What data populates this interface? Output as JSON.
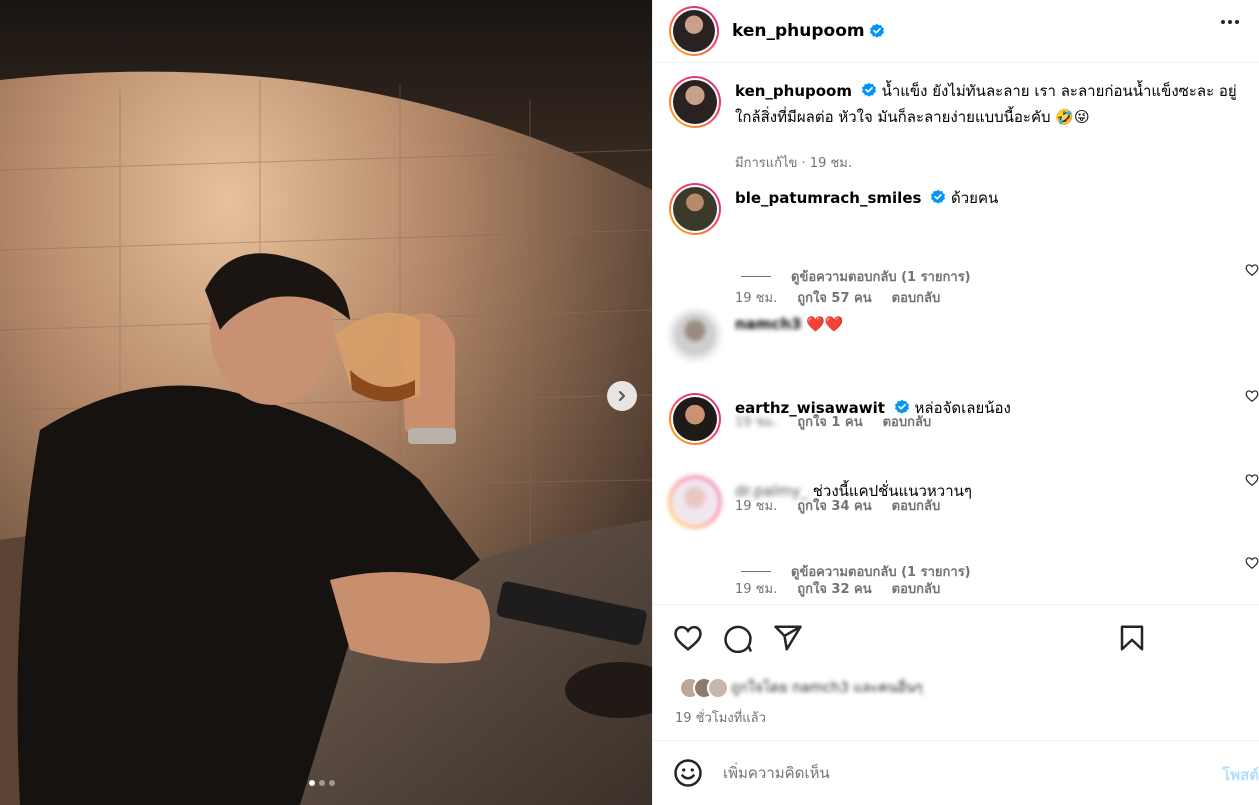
{
  "author": {
    "username": "ken_phupoom",
    "verified": true
  },
  "caption": {
    "username": "ken_phupoom",
    "text": "น้ำแข็ง ยังไม่ทันละลาย เรา ละลายก่อนน้ำแข็งซะละ อยู่ใกล้สิ่งที่มีผลต่อ หัวใจ มันก็ละลายง่ายแบบนี้อะคับ 🤣😜",
    "meta": "มีการแก้ไข · 19 ชม."
  },
  "comments": [
    {
      "username": "ble_patumrach_smiles",
      "verified": true,
      "text": "ด้วยคน",
      "time": "19 ชม.",
      "likes": "ถูกใจ 57 คน",
      "reply": "ตอบกลับ",
      "view_replies": "ดูข้อความตอบกลับ (1 รายการ)"
    },
    {
      "username": "namch3",
      "verified": false,
      "text": "❤️❤️",
      "time": "19 ชม.",
      "likes": "ถูกใจ 1 คน",
      "reply": "ตอบกลับ"
    },
    {
      "username": "earthz_wisawawit",
      "verified": true,
      "text": "หล่อจัดเลยน้อง",
      "time": "19 ชม.",
      "likes": "ถูกใจ 34 คน",
      "reply": "ตอบกลับ"
    },
    {
      "username": "dr.palmy_",
      "verified": false,
      "text": "ช่วงนี้แคปชั่นแนวหวานๆ",
      "time": "19 ชม.",
      "likes": "ถูกใจ 32 คน",
      "reply": "ตอบกลับ",
      "view_replies": "ดูข้อความตอบกลับ (1 รายการ)"
    }
  ],
  "likes_summary": "ถูกใจโดย namch3 และคนอื่นๆ",
  "posted_ago": "19 ชั่วโมงที่แล้ว",
  "comment_box": {
    "placeholder": "เพิ่มความคิดเห็น",
    "post_label": "โพสต์"
  },
  "carousel": {
    "count": 3,
    "active": 1
  },
  "colors": {
    "verified": "#0095f6",
    "ring_start": "#f9c200",
    "ring_end": "#c13584",
    "post_disabled": "#b2dffc"
  }
}
